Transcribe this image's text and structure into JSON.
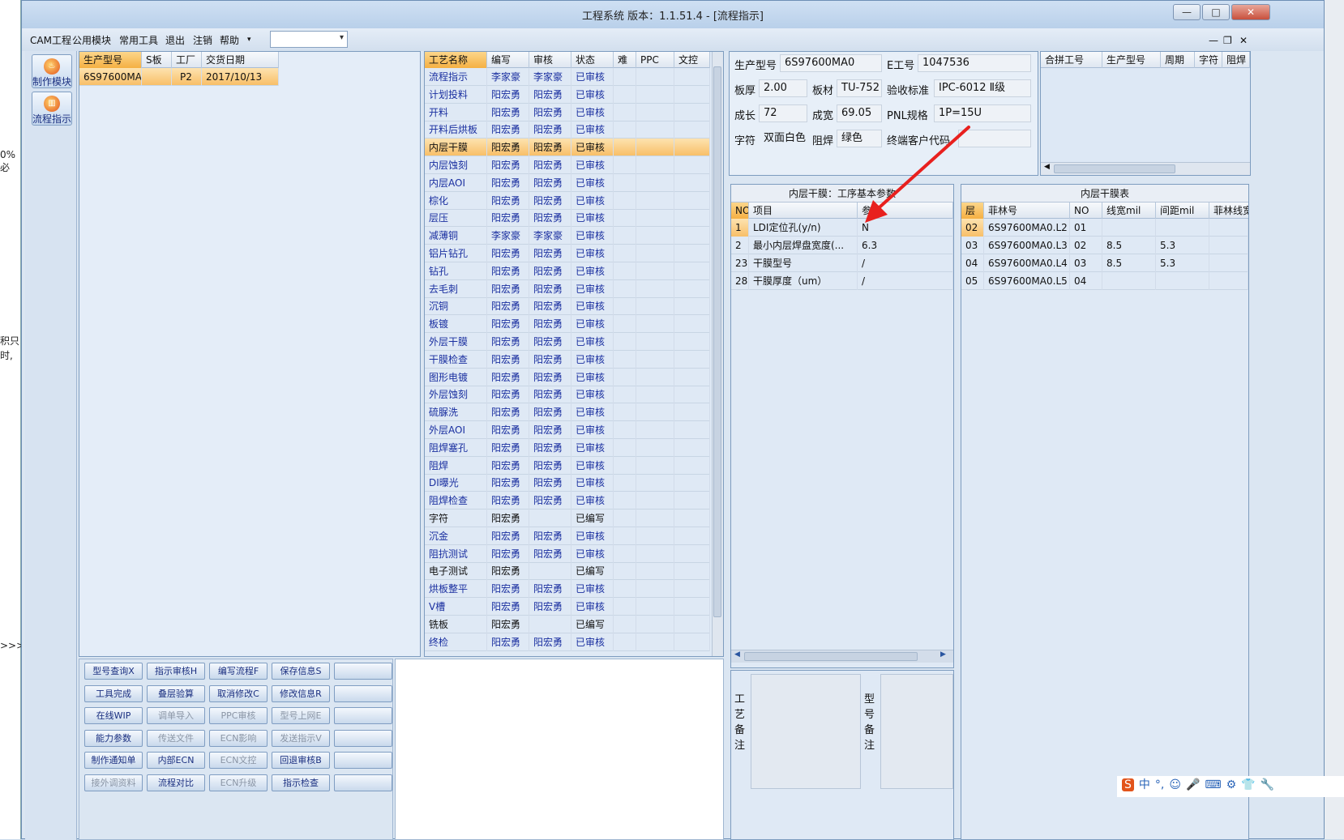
{
  "window": {
    "title": "工程系统  版本：1.1.51.4 - [流程指示]",
    "min": "—",
    "max": "□",
    "close": "✕"
  },
  "background_text": [
    "0%必",
    "积只",
    "时,",
    ">>>"
  ],
  "menu": {
    "items": [
      "CAM工程",
      "公用模块",
      "常用工具",
      "退出",
      "注销",
      "帮助"
    ],
    "dropdown_value": "",
    "mdi_min": "—",
    "mdi_restore": "❐",
    "mdi_close": "✕"
  },
  "left_toolbar": [
    {
      "label": "制作模块",
      "icon": "flame-icon"
    },
    {
      "label": "流程指示",
      "icon": "process-icon"
    }
  ],
  "orders_table": {
    "columns": [
      "生产型号",
      "S板",
      "工厂",
      "交货日期"
    ],
    "rows": [
      [
        "6S97600MA0",
        "",
        "P2",
        "2017/10/13"
      ]
    ]
  },
  "process_table": {
    "columns": [
      "工艺名称",
      "编写",
      "审核",
      "状态",
      "难",
      "PPC",
      "文控"
    ],
    "rows": [
      [
        "流程指示",
        "李家豪",
        "李家豪",
        "已审核"
      ],
      [
        "计划投料",
        "阳宏勇",
        "阳宏勇",
        "已审核"
      ],
      [
        "开料",
        "阳宏勇",
        "阳宏勇",
        "已审核"
      ],
      [
        "开料后烘板",
        "阳宏勇",
        "阳宏勇",
        "已审核"
      ],
      [
        "内层干膜",
        "阳宏勇",
        "阳宏勇",
        "已审核"
      ],
      [
        "内层蚀刻",
        "阳宏勇",
        "阳宏勇",
        "已审核"
      ],
      [
        "内层AOI",
        "阳宏勇",
        "阳宏勇",
        "已审核"
      ],
      [
        "棕化",
        "阳宏勇",
        "阳宏勇",
        "已审核"
      ],
      [
        "层压",
        "阳宏勇",
        "阳宏勇",
        "已审核"
      ],
      [
        "减薄铜",
        "李家豪",
        "李家豪",
        "已审核"
      ],
      [
        "铝片钻孔",
        "阳宏勇",
        "阳宏勇",
        "已审核"
      ],
      [
        "钻孔",
        "阳宏勇",
        "阳宏勇",
        "已审核"
      ],
      [
        "去毛刺",
        "阳宏勇",
        "阳宏勇",
        "已审核"
      ],
      [
        "沉铜",
        "阳宏勇",
        "阳宏勇",
        "已审核"
      ],
      [
        "板镀",
        "阳宏勇",
        "阳宏勇",
        "已审核"
      ],
      [
        "外层干膜",
        "阳宏勇",
        "阳宏勇",
        "已审核"
      ],
      [
        "干膜检查",
        "阳宏勇",
        "阳宏勇",
        "已审核"
      ],
      [
        "图形电镀",
        "阳宏勇",
        "阳宏勇",
        "已审核"
      ],
      [
        "外层蚀刻",
        "阳宏勇",
        "阳宏勇",
        "已审核"
      ],
      [
        "硫脲洗",
        "阳宏勇",
        "阳宏勇",
        "已审核"
      ],
      [
        "外层AOI",
        "阳宏勇",
        "阳宏勇",
        "已审核"
      ],
      [
        "阻焊塞孔",
        "阳宏勇",
        "阳宏勇",
        "已审核"
      ],
      [
        "阻焊",
        "阳宏勇",
        "阳宏勇",
        "已审核"
      ],
      [
        "DI曝光",
        "阳宏勇",
        "阳宏勇",
        "已审核"
      ],
      [
        "阻焊检查",
        "阳宏勇",
        "阳宏勇",
        "已审核"
      ],
      [
        "字符",
        "阳宏勇",
        "",
        "已编写"
      ],
      [
        "沉金",
        "阳宏勇",
        "阳宏勇",
        "已审核"
      ],
      [
        "阻抗测试",
        "阳宏勇",
        "阳宏勇",
        "已审核"
      ],
      [
        "电子测试",
        "阳宏勇",
        "",
        "已编写"
      ],
      [
        "烘板整平",
        "阳宏勇",
        "阳宏勇",
        "已审核"
      ],
      [
        "V槽",
        "阳宏勇",
        "阳宏勇",
        "已审核"
      ],
      [
        "铣板",
        "阳宏勇",
        "",
        "已编写"
      ],
      [
        "终检",
        "阳宏勇",
        "阳宏勇",
        "已审核"
      ]
    ]
  },
  "info": {
    "prod_model_label": "生产型号",
    "prod_model": "6S97600MA0",
    "eno_label": "E工号",
    "eno": "1047536",
    "thickness_label": "板厚",
    "thickness": "2.00",
    "material_label": "板材",
    "material": "TU-752",
    "standard_label": "验收标准",
    "standard": "IPC-6012 Ⅱ级",
    "length_label": "成长",
    "length": "72",
    "width_label": "成宽",
    "width": "69.05",
    "pnl_label": "PNL规格",
    "pnl": "1P=15U",
    "char_label": "字符",
    "char": "双面白色",
    "mask_label": "阻焊",
    "mask": "绿色",
    "endcode_label": "终端客户代码",
    "endcode": ""
  },
  "panel_table": {
    "columns": [
      "合拼工号",
      "生产型号",
      "周期",
      "字符",
      "阻焊"
    ]
  },
  "params": {
    "title": "内层干膜：工序基本参数",
    "columns": [
      "NO",
      "项目",
      "参数"
    ],
    "rows": [
      [
        "1",
        "LDI定位孔(y/n)",
        "N"
      ],
      [
        "2",
        "最小内层焊盘宽度(...",
        "6.3"
      ],
      [
        "23",
        "干膜型号",
        "/"
      ],
      [
        "28",
        "干膜厚度（um）",
        "/"
      ]
    ]
  },
  "film": {
    "title": "内层干膜表",
    "columns": [
      "层",
      "菲林号",
      "NO",
      "线宽mil",
      "间距mil",
      "菲林线宽"
    ],
    "rows": [
      [
        "02",
        "6S97600MA0.L2",
        "01",
        "",
        "",
        ""
      ],
      [
        "03",
        "6S97600MA0.L3",
        "02",
        "8.5",
        "5.3",
        ""
      ],
      [
        "04",
        "6S97600MA0.L4",
        "03",
        "8.5",
        "5.3",
        ""
      ],
      [
        "05",
        "6S97600MA0.L5",
        "04",
        "",
        "",
        ""
      ]
    ]
  },
  "notes": {
    "process_label": "工艺备注",
    "model_label": "型号备注"
  },
  "buttons": [
    [
      {
        "t": "型号查询X",
        "d": false
      },
      {
        "t": "指示审核H",
        "d": false
      },
      {
        "t": "编写流程F",
        "d": false
      },
      {
        "t": "保存信息S",
        "d": false
      },
      {
        "t": "",
        "d": false
      }
    ],
    [
      {
        "t": "工具完成",
        "d": false
      },
      {
        "t": "叠层验算",
        "d": false
      },
      {
        "t": "取消修改C",
        "d": false
      },
      {
        "t": "修改信息R",
        "d": false
      },
      {
        "t": "",
        "d": false
      }
    ],
    [
      {
        "t": "在线WIP",
        "d": false
      },
      {
        "t": "调单导入",
        "d": true
      },
      {
        "t": "PPC审核",
        "d": true
      },
      {
        "t": "型号上网E",
        "d": true
      },
      {
        "t": "",
        "d": false
      }
    ],
    [
      {
        "t": "能力参数",
        "d": false
      },
      {
        "t": "传送文件",
        "d": true
      },
      {
        "t": "ECN影响",
        "d": true
      },
      {
        "t": "发送指示V",
        "d": true
      },
      {
        "t": "",
        "d": false
      }
    ],
    [
      {
        "t": "制作通知单",
        "d": false
      },
      {
        "t": "内部ECN",
        "d": false
      },
      {
        "t": "ECN文控",
        "d": true
      },
      {
        "t": "回退审核B",
        "d": false
      },
      {
        "t": "",
        "d": false
      }
    ],
    [
      {
        "t": "接外调资料",
        "d": true
      },
      {
        "t": "流程对比",
        "d": false
      },
      {
        "t": "ECN升级",
        "d": true
      },
      {
        "t": "指示检查",
        "d": false
      },
      {
        "t": "",
        "d": false
      }
    ]
  ],
  "ime": [
    "S",
    "中",
    "°,",
    "☺",
    "🎤",
    "⌨",
    "⚙",
    "👕",
    "🔧"
  ],
  "colors": {
    "selection": "#f8bf68",
    "link": "#1a2fa0",
    "arrow": "#e8201e"
  }
}
